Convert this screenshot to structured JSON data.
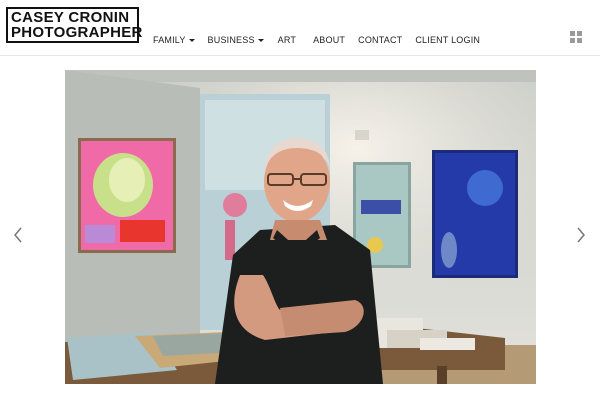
{
  "brand": {
    "line1": "CASEY CRONIN",
    "line2": "PHOTOGRAPHER"
  },
  "nav": {
    "items": [
      {
        "label": "FAMILY",
        "dropdown": true
      },
      {
        "label": "BUSINESS",
        "dropdown": true
      },
      {
        "label": "ART",
        "dropdown": false
      },
      {
        "label": "ABOUT",
        "dropdown": false
      },
      {
        "label": "CONTACT",
        "dropdown": false
      },
      {
        "label": "CLIENT LOGIN",
        "dropdown": false
      }
    ]
  },
  "icons": {
    "menu": "grid-icon",
    "prev": "chevron-left-icon",
    "next": "chevron-right-icon"
  },
  "colors": {
    "text": "#222222",
    "icon": "#9a9a9a",
    "background": "#ffffff"
  }
}
